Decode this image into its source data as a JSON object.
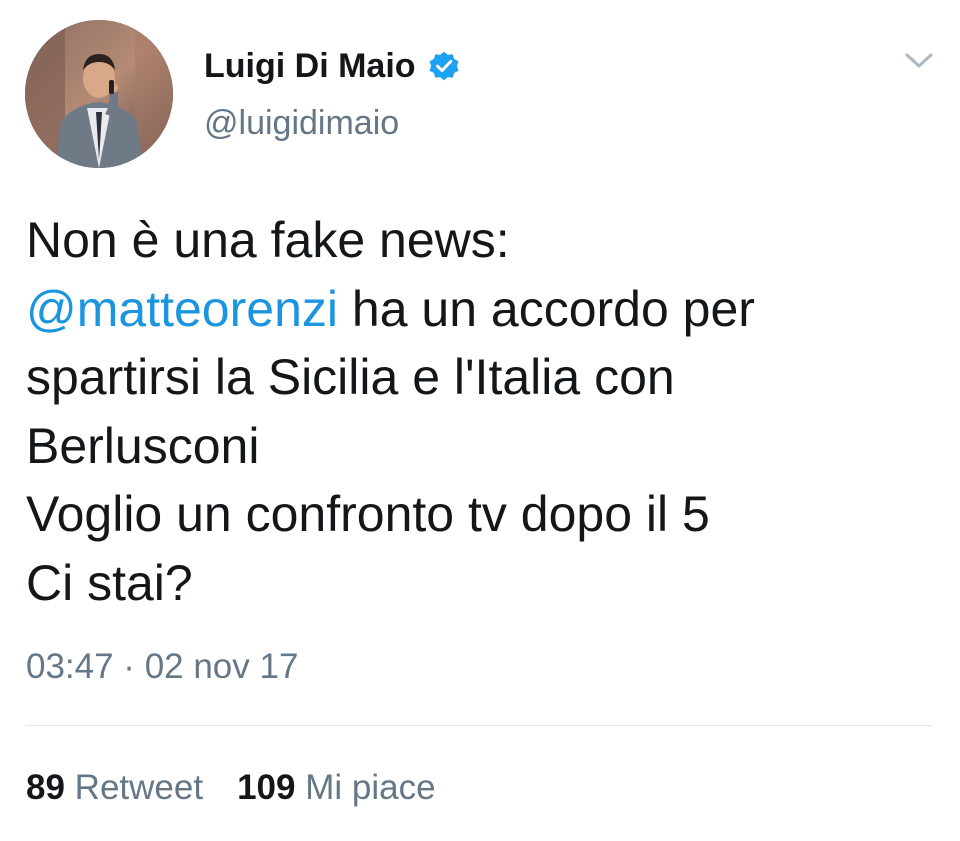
{
  "author": {
    "display_name": "Luigi Di Maio",
    "handle": "@luigidimaio"
  },
  "tweet": {
    "mention": "@matteorenzi",
    "lines": [
      "Non è una fake news:",
      " ha un accordo per",
      "spartirsi la Sicilia e l'Italia con",
      "Berlusconi",
      "Voglio un confronto tv dopo il 5",
      "Ci stai?"
    ],
    "timestamp": "03:47 · 02 nov 17"
  },
  "stats": {
    "retweets_count": "89",
    "retweets_label": "Retweet",
    "likes_count": "109",
    "likes_label": "Mi piace"
  },
  "icons": {
    "verified": "verified-badge-icon",
    "menu": "chevron-down-icon"
  },
  "colors": {
    "mention": "#1b95e0",
    "secondary_text": "#657786",
    "verified": "#1da1f2"
  }
}
